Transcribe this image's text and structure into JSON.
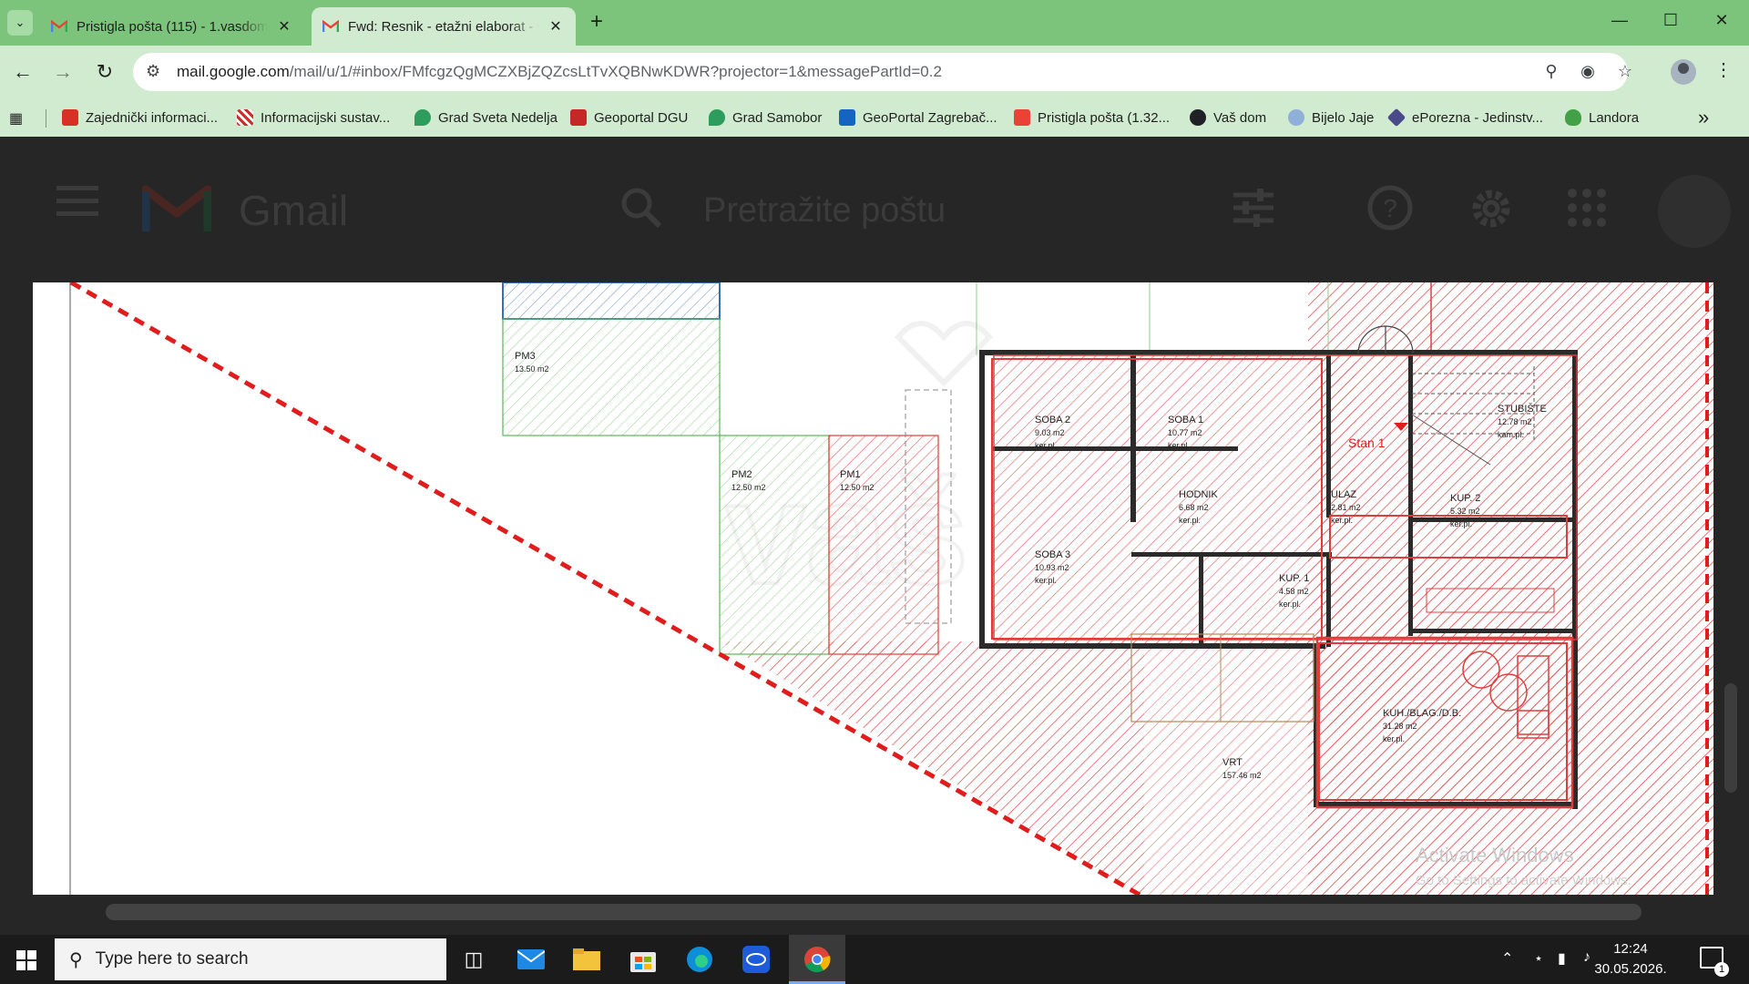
{
  "browser": {
    "tabs": [
      {
        "title": "Pristigla pošta (115) - 1.vasdom",
        "active": false
      },
      {
        "title": "Fwd: Resnik - etažni elaborat - vasdom",
        "active": true
      }
    ],
    "url_host": "mail.google.com",
    "url_rest": "/mail/u/1/#inbox/FMfcgzQgMCZXBjZQZcsLtTvXQBNwKDWR?projector=1&messagePartId=0.2",
    "bookmarks": [
      "Zajednički informaci...",
      "Informacijski sustav...",
      "Grad Sveta Nedelja",
      "Geoportal DGU",
      "Grad Samobor",
      "GeoPortal Zagrebač...",
      "Pristigla pošta (1.32...",
      "Vaš dom",
      "Bijelo Jaje",
      "ePorezna - Jedinstv...",
      "Landora"
    ],
    "bookmark_colors": [
      "#d93025",
      "#c9302c",
      "#2e9c5c",
      "#c62828",
      "#2e9c5c",
      "#1565c0",
      "#ea4335",
      "#202124",
      "#8fb0d8",
      "#4a4a8a",
      "#43a047"
    ]
  },
  "gmail": {
    "logo_text": "Gmail",
    "search_placeholder": "Pretražite poštu"
  },
  "plan": {
    "rooms": [
      {
        "name": "PM3",
        "area": "13.50 m2"
      },
      {
        "name": "PM2",
        "area": "12.50 m2"
      },
      {
        "name": "PM1",
        "area": "12.50 m2"
      },
      {
        "name": "SOBA 2",
        "area": "9.03 m2",
        "floor": "ker.pl."
      },
      {
        "name": "SOBA 1",
        "area": "10.77 m2",
        "floor": "ker.pl."
      },
      {
        "name": "HODNIK",
        "area": "6.68 m2",
        "floor": "ker.pl."
      },
      {
        "name": "ULAZ",
        "area": "2.81 m2",
        "floor": "ker.pl."
      },
      {
        "name": "STUBIŠTE",
        "area": "12.78 m2",
        "floor": "kam.pl."
      },
      {
        "name": "KUP. 2",
        "area": "5.32 m2",
        "floor": "ker.pl."
      },
      {
        "name": "SOBA 3",
        "area": "10.93 m2",
        "floor": "ker.pl."
      },
      {
        "name": "KUP. 1",
        "area": "4.58 m2",
        "floor": "ker.pl."
      },
      {
        "name": "KUH./BLAG./D.B.",
        "area": "31.28 m2",
        "floor": "ker.pl."
      },
      {
        "name": "VRT",
        "area": "157.46 m2"
      }
    ],
    "unit_label": "Stan 1",
    "activate_title": "Activate Windows",
    "activate_sub": "Go to Settings to activate Windows."
  },
  "taskbar": {
    "search_placeholder": "Type here to search",
    "time": "12:24",
    "date": "30.05.2026.",
    "notifications": "1"
  }
}
